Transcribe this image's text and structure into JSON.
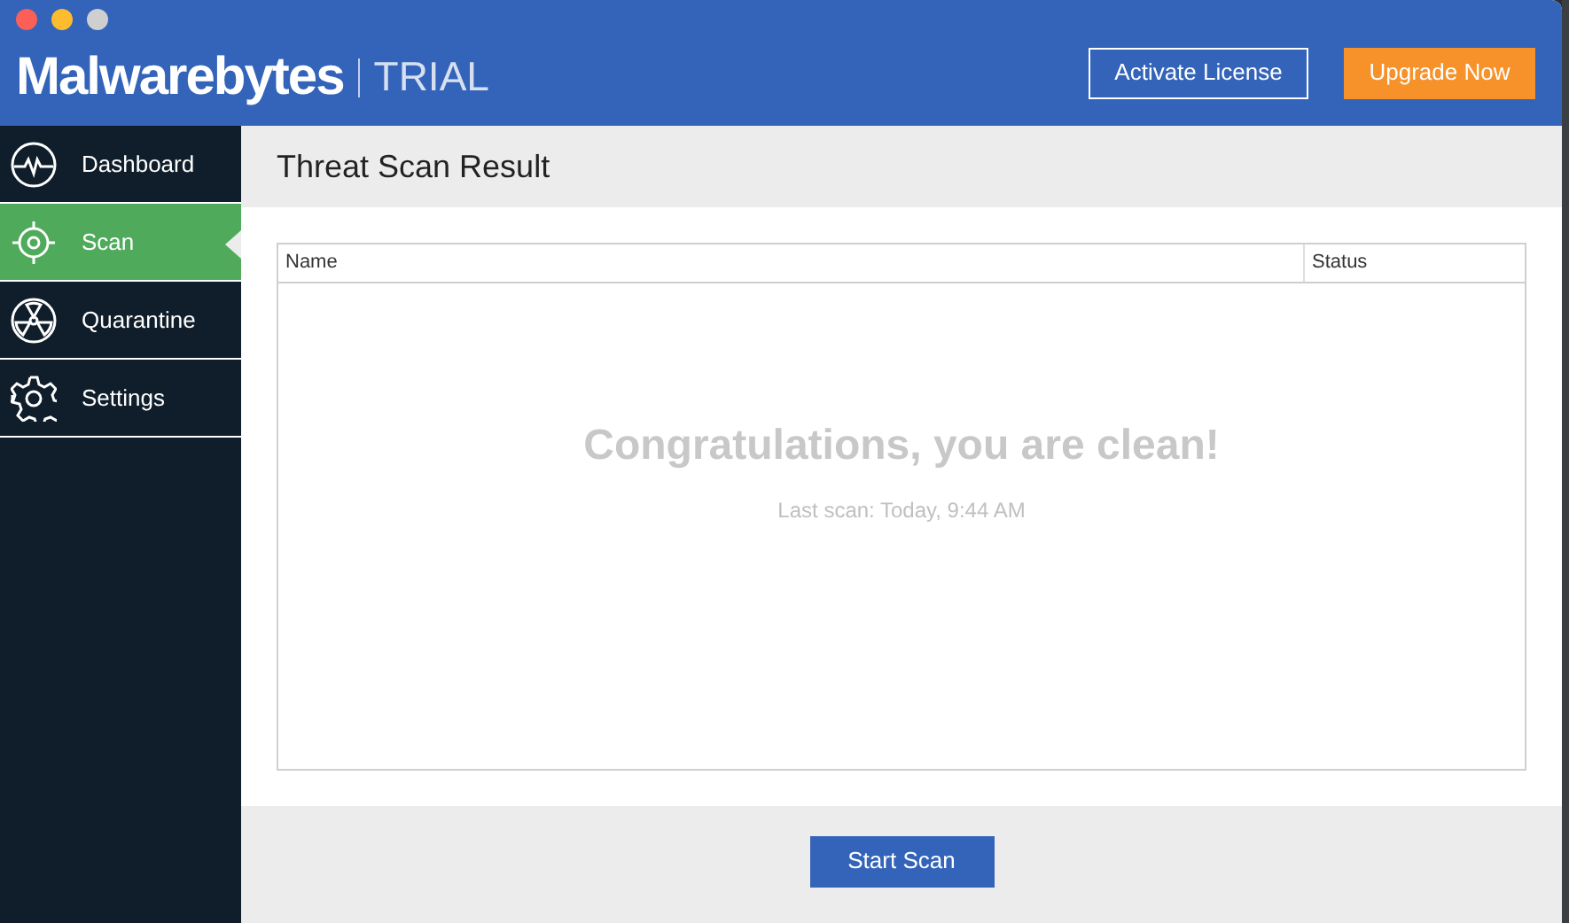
{
  "header": {
    "logo": "Malwarebytes",
    "edition": "TRIAL",
    "buttons": [
      {
        "label": "Activate License",
        "kind": "outline"
      },
      {
        "label": "Upgrade Now",
        "kind": "primary"
      }
    ]
  },
  "sidebar": {
    "items": [
      {
        "label": "Dashboard",
        "selected": false
      },
      {
        "label": "Scan",
        "selected": true
      },
      {
        "label": "Quarantine",
        "selected": false
      },
      {
        "label": "Settings",
        "selected": false
      }
    ]
  },
  "page_title": "Threat Scan Result",
  "table": {
    "columns": [
      "Name",
      "Status"
    ],
    "empty_title": "Congratulations, you are clean!",
    "empty_subtitle": "Last scan: Today, 9:44 AM"
  },
  "footer": {
    "button": "Start Scan"
  }
}
